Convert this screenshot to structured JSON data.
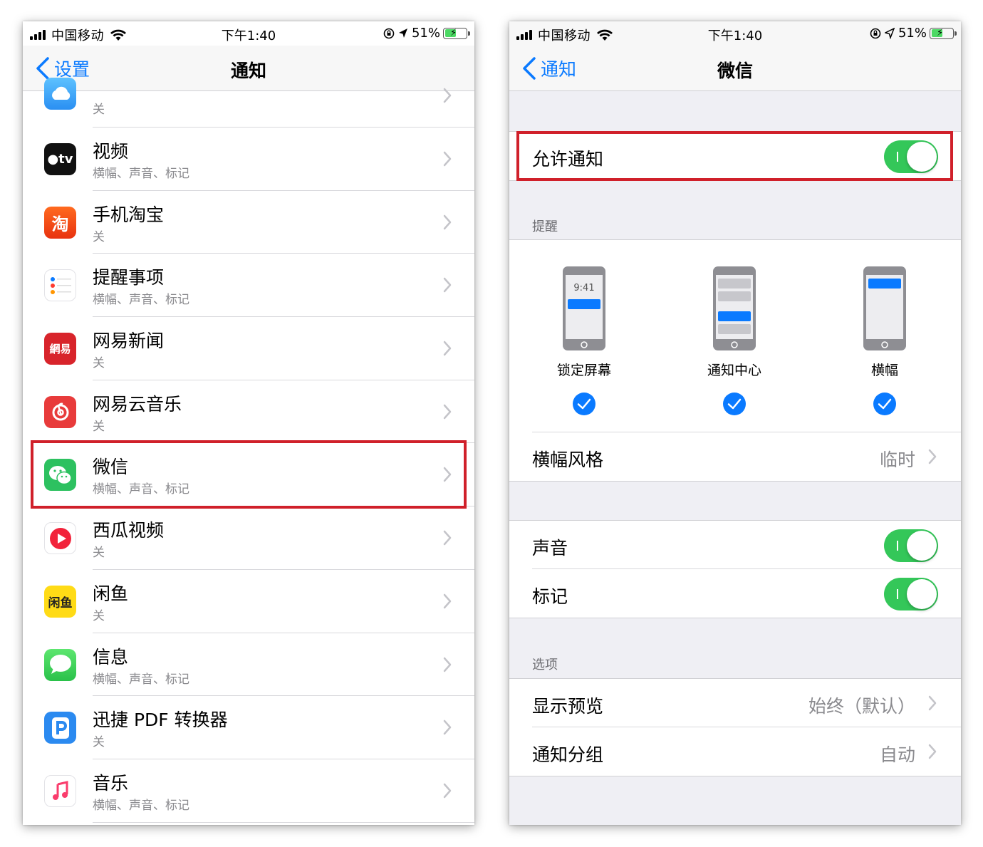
{
  "status_bar": {
    "carrier": "中国移动",
    "time": "下午1:40",
    "battery": "51%",
    "battery_level": 0.51,
    "battery_color": "#4cd964"
  },
  "left": {
    "nav": {
      "back_label": "设置",
      "title": "通知"
    },
    "apps": [
      {
        "name": "",
        "sub": "关",
        "icon": "weather-app-icon",
        "color": "#2a9cf2",
        "partial": true
      },
      {
        "name": "视频",
        "sub": "横幅、声音、标记",
        "icon": "apple-tv-icon",
        "color": "#111111"
      },
      {
        "name": "手机淘宝",
        "sub": "关",
        "icon": "taobao-icon",
        "color": "#f2501d"
      },
      {
        "name": "提醒事项",
        "sub": "横幅、声音、标记",
        "icon": "reminders-icon",
        "color": "#ffffff"
      },
      {
        "name": "网易新闻",
        "sub": "关",
        "icon": "netease-news-icon",
        "color": "#d8242b"
      },
      {
        "name": "网易云音乐",
        "sub": "关",
        "icon": "netease-music-icon",
        "color": "#e83b3b"
      },
      {
        "name": "微信",
        "sub": "横幅、声音、标记",
        "icon": "wechat-icon",
        "color": "#2dc160"
      },
      {
        "name": "西瓜视频",
        "sub": "关",
        "icon": "xigua-video-icon",
        "color": "#ffffff"
      },
      {
        "name": "闲鱼",
        "sub": "关",
        "icon": "xianyu-icon",
        "color": "#ffdb16"
      },
      {
        "name": "信息",
        "sub": "横幅、声音、标记",
        "icon": "messages-icon",
        "color": "#33c759"
      },
      {
        "name": "迅捷 PDF 转换器",
        "sub": "关",
        "icon": "pdf-converter-icon",
        "color": "#2b8af0"
      },
      {
        "name": "音乐",
        "sub": "横幅、声音、标记",
        "icon": "music-icon",
        "color": "#ffffff"
      }
    ]
  },
  "right": {
    "nav": {
      "back_label": "通知",
      "title": "微信"
    },
    "allow_notifications": {
      "label": "允许通知",
      "on": true
    },
    "alerts_header": "提醒",
    "alert_styles": [
      {
        "label": "锁定屏幕",
        "preview_time": "9:41",
        "checked": true
      },
      {
        "label": "通知中心",
        "checked": true
      },
      {
        "label": "横幅",
        "checked": true
      }
    ],
    "banner_style": {
      "label": "横幅风格",
      "value": "临时"
    },
    "sounds": {
      "label": "声音",
      "on": true
    },
    "badges": {
      "label": "标记",
      "on": true
    },
    "options_header": "选项",
    "show_previews": {
      "label": "显示预览",
      "value": "始终（默认）"
    },
    "grouping": {
      "label": "通知分组",
      "value": "自动"
    },
    "accent_color": "#0a7aff",
    "toggle_color": "#34c759",
    "highlight_color": "#d0202a"
  }
}
